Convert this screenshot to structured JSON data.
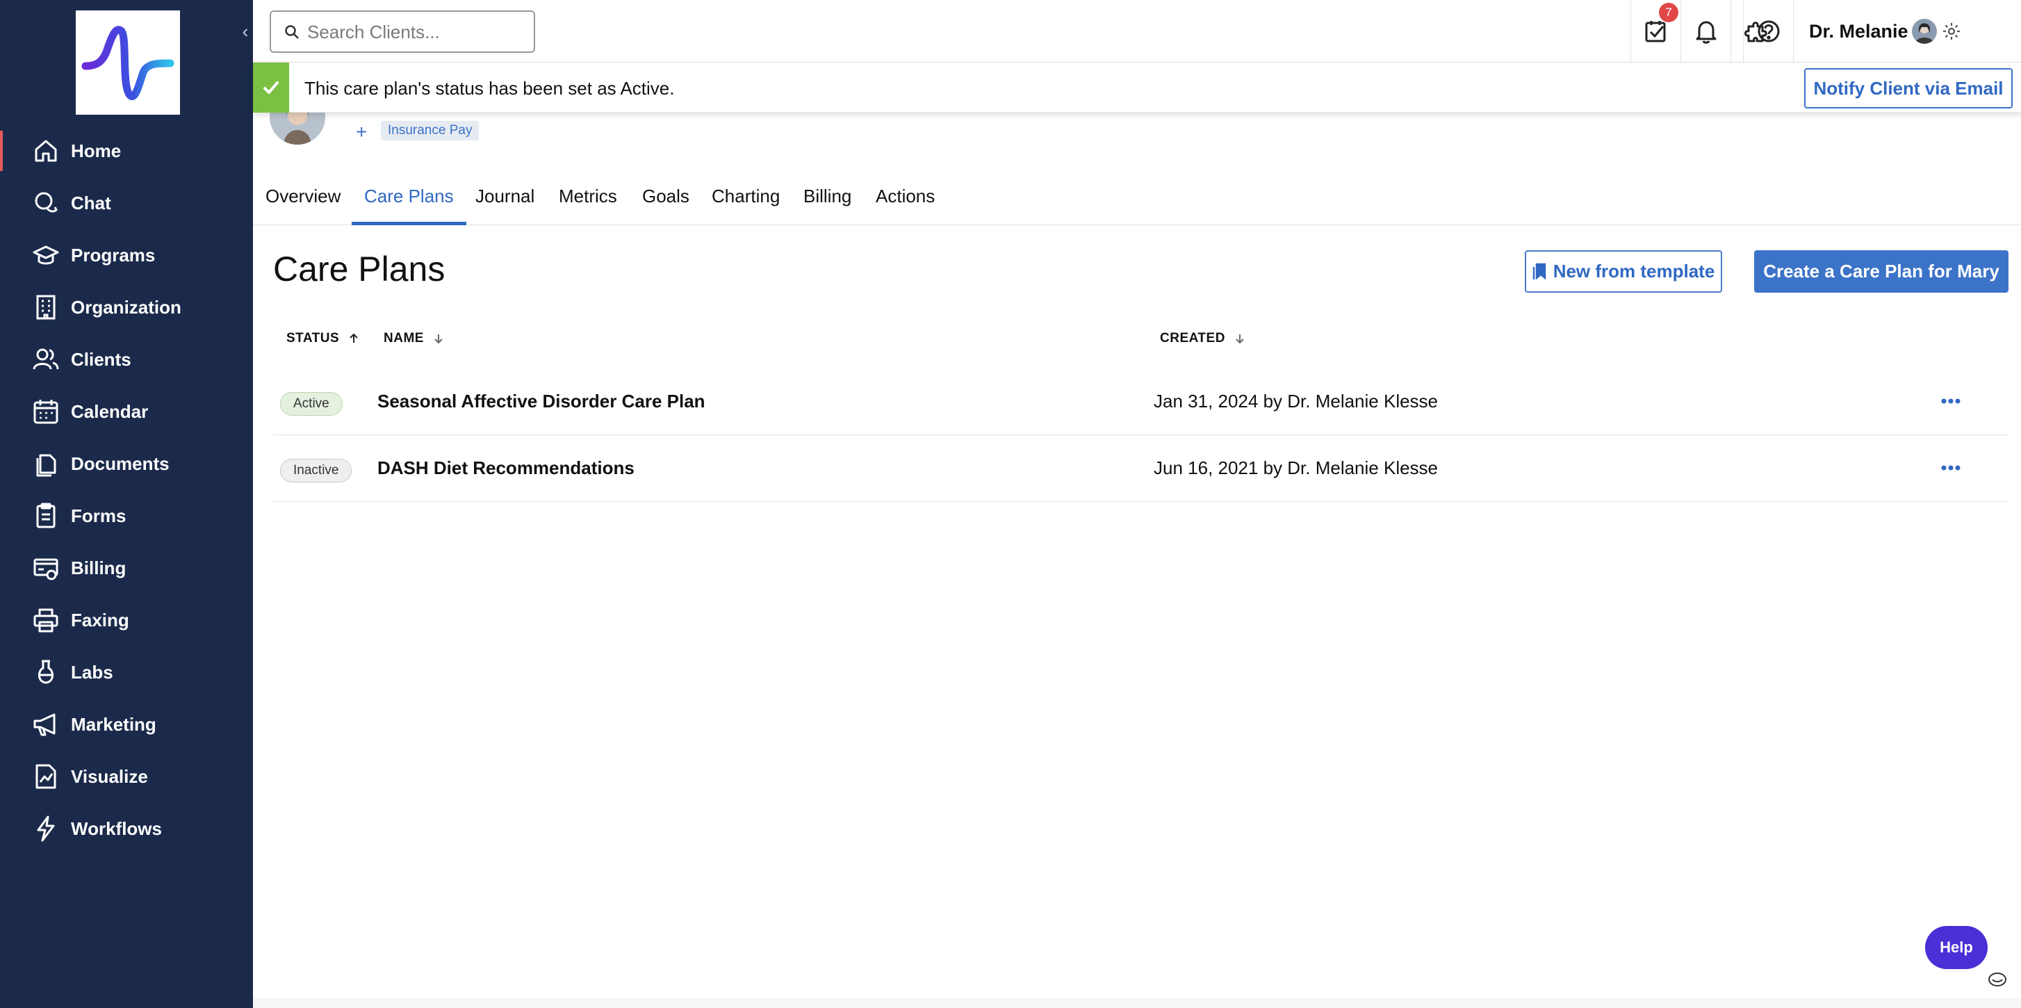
{
  "sidebar": {
    "collapse_glyph": "‹",
    "items": [
      {
        "label": "Home",
        "icon": "home-icon",
        "active": true
      },
      {
        "label": "Chat",
        "icon": "chat-icon"
      },
      {
        "label": "Programs",
        "icon": "graduation-cap-icon"
      },
      {
        "label": "Organization",
        "icon": "building-icon"
      },
      {
        "label": "Clients",
        "icon": "users-icon"
      },
      {
        "label": "Calendar",
        "icon": "calendar-icon"
      },
      {
        "label": "Documents",
        "icon": "documents-icon"
      },
      {
        "label": "Forms",
        "icon": "clipboard-icon"
      },
      {
        "label": "Billing",
        "icon": "billing-icon"
      },
      {
        "label": "Faxing",
        "icon": "printer-icon"
      },
      {
        "label": "Labs",
        "icon": "flask-icon"
      },
      {
        "label": "Marketing",
        "icon": "megaphone-icon"
      },
      {
        "label": "Visualize",
        "icon": "chart-file-icon"
      },
      {
        "label": "Workflows",
        "icon": "lightning-icon"
      }
    ]
  },
  "topbar": {
    "search_placeholder": "Search Clients...",
    "tasks_badge": "7",
    "user_name": "Dr. Melanie"
  },
  "toast": {
    "message": "This care plan's status has been set as Active.",
    "action_label": "Notify Client via Email"
  },
  "client": {
    "add_tag_glyph": "+",
    "tag": "Insurance Pay"
  },
  "tabs": [
    {
      "label": "Overview"
    },
    {
      "label": "Care Plans",
      "active": true
    },
    {
      "label": "Journal"
    },
    {
      "label": "Metrics"
    },
    {
      "label": "Goals"
    },
    {
      "label": "Charting"
    },
    {
      "label": "Billing"
    },
    {
      "label": "Actions"
    }
  ],
  "content": {
    "title": "Care Plans",
    "template_button": "New from template",
    "create_button": "Create a Care Plan for Mary",
    "columns": {
      "status": "STATUS",
      "name": "NAME",
      "created": "CREATED"
    },
    "rows": [
      {
        "status": "Active",
        "name": "Seasonal Affective Disorder Care Plan",
        "created": "Jan 31, 2024 by Dr. Melanie Klesse"
      },
      {
        "status": "Inactive",
        "name": "DASH Diet Recommendations",
        "created": "Jun 16, 2021 by Dr. Melanie Klesse"
      }
    ]
  },
  "help": {
    "label": "Help"
  },
  "colors": {
    "sidebar_bg": "#1b2a4a",
    "accent_blue": "#3b73c8",
    "success_green": "#7cc043",
    "badge_red": "#e04848",
    "help_purple": "#4a2fd6"
  }
}
